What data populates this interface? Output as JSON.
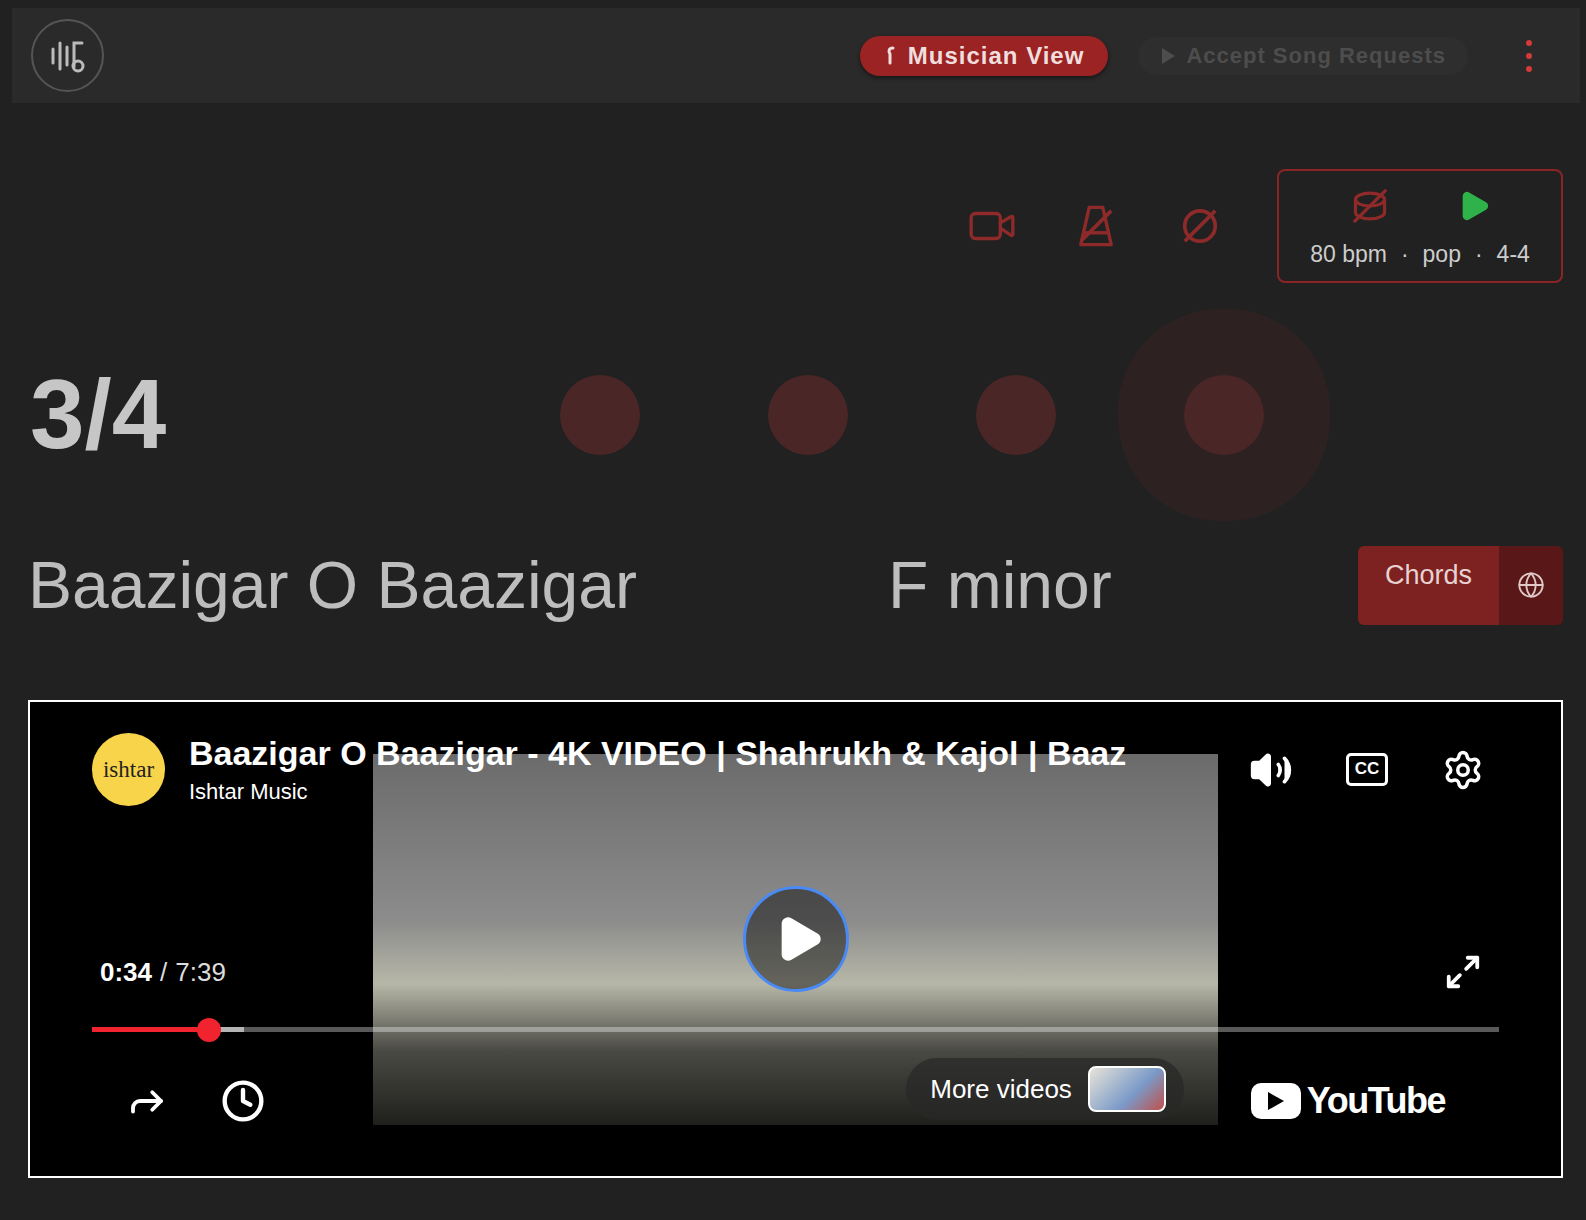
{
  "topbar": {
    "musician_view": {
      "label": "Musician View",
      "selected": true
    },
    "song_requests": {
      "label": "Accept Song Requests",
      "disabled": true
    }
  },
  "tools": [
    {
      "kind": "video",
      "on": true
    },
    {
      "kind": "metronome",
      "on": false
    },
    {
      "kind": "slash",
      "on": false
    }
  ],
  "backing": {
    "drums_on": false,
    "playing": false,
    "bpm": "80 bpm",
    "style": "pop",
    "meter": "4-4",
    "separator": "·"
  },
  "beat": {
    "signature": "3/4",
    "beats": [
      {
        "active": false
      },
      {
        "active": false
      },
      {
        "active": false
      },
      {
        "active": true
      }
    ]
  },
  "song": {
    "title": "Baazigar O Baazigar",
    "key": "F minor",
    "chords_button": "Chords"
  },
  "video": {
    "avatar": "ishtar",
    "title": "Baazigar O Baazigar - 4K VIDEO | Shahrukh & Kajol | Baaz",
    "channel": "Ishtar Music",
    "cc": "CC",
    "current": "0:34",
    "separator": "/",
    "duration": "7:39",
    "level": 0.083,
    "buffered": 0.108,
    "playing": false,
    "more_videos": "More videos",
    "brand": "YouTube"
  }
}
